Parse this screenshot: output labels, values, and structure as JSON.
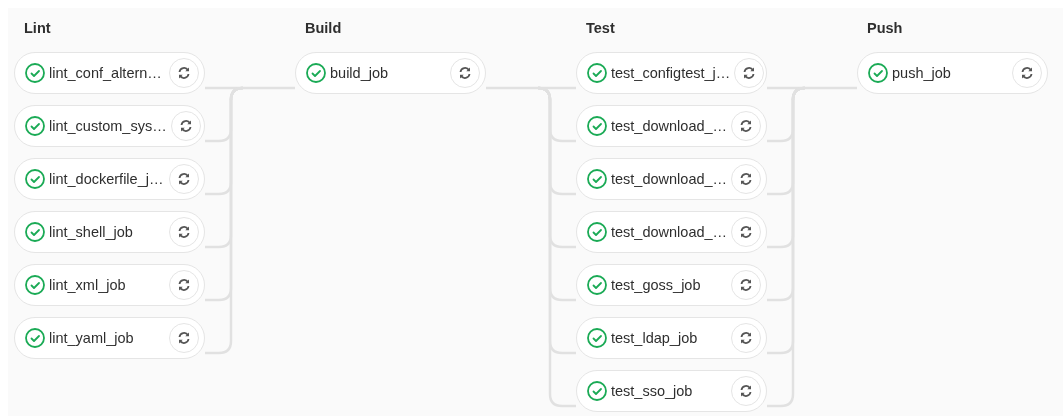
{
  "stages": [
    {
      "title": "Lint",
      "jobs": [
        {
          "name": "lint_conf_altern…",
          "kind": "success"
        },
        {
          "name": "lint_custom_sys…",
          "kind": "success"
        },
        {
          "name": "lint_dockerfile_j…",
          "kind": "success"
        },
        {
          "name": "lint_shell_job",
          "kind": "success"
        },
        {
          "name": "lint_xml_job",
          "kind": "success"
        },
        {
          "name": "lint_yaml_job",
          "kind": "success"
        }
      ]
    },
    {
      "title": "Build",
      "jobs": [
        {
          "name": "build_job",
          "kind": "success"
        }
      ]
    },
    {
      "title": "Test",
      "jobs": [
        {
          "name": "test_configtest_j…",
          "kind": "success"
        },
        {
          "name": "test_download_…",
          "kind": "success"
        },
        {
          "name": "test_download_…",
          "kind": "success"
        },
        {
          "name": "test_download_…",
          "kind": "success"
        },
        {
          "name": "test_goss_job",
          "kind": "success"
        },
        {
          "name": "test_ldap_job",
          "kind": "success"
        },
        {
          "name": "test_sso_job",
          "kind": "success"
        }
      ]
    },
    {
      "title": "Push",
      "jobs": [
        {
          "name": "push_job",
          "kind": "success"
        }
      ]
    }
  ]
}
